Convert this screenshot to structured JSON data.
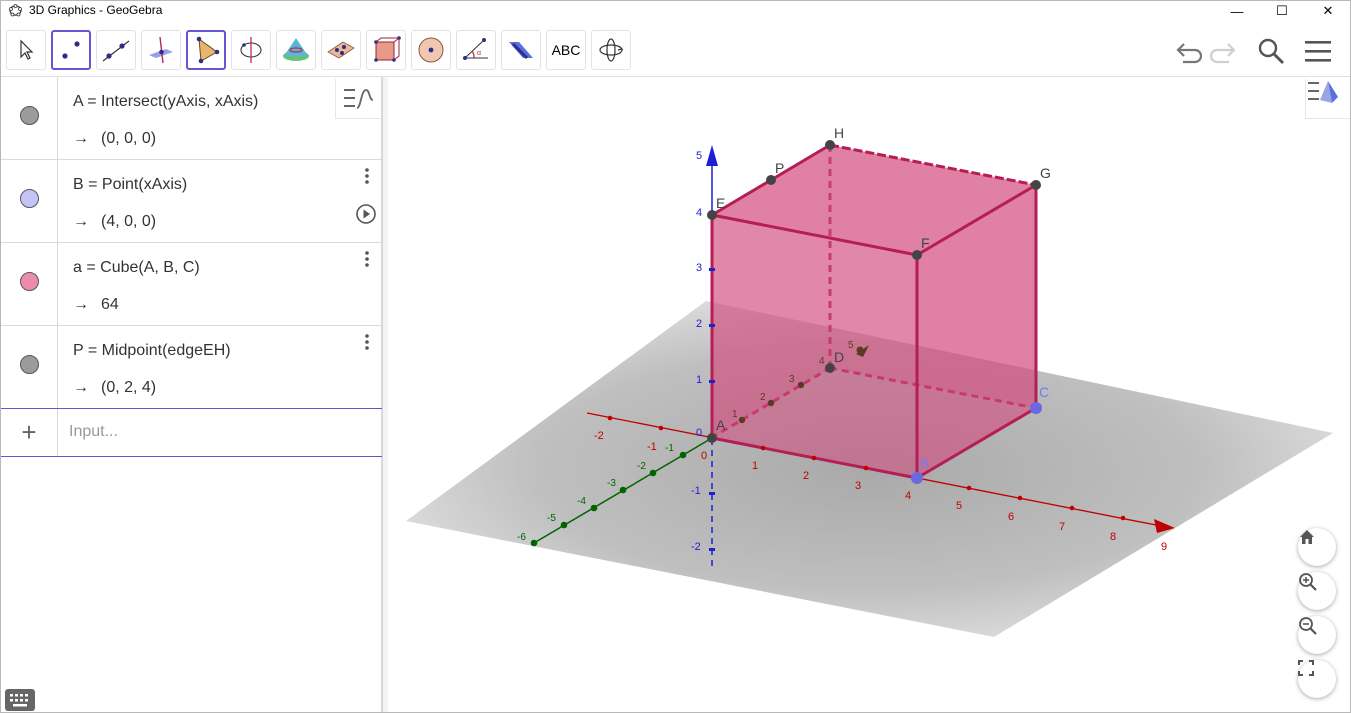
{
  "window": {
    "title": "3D Graphics - GeoGebra",
    "minimize_glyph": "—",
    "maximize_glyph": "☐",
    "close_glyph": "✕"
  },
  "toolbar": {
    "tools": [
      {
        "name": "move-tool-icon",
        "selected": false
      },
      {
        "name": "point-tool-icon",
        "selected": true
      },
      {
        "name": "line-tool-icon",
        "selected": false
      },
      {
        "name": "perpendicular-line-tool-icon",
        "selected": false
      },
      {
        "name": "polygon-tool-icon",
        "selected": true
      },
      {
        "name": "circle-axis-tool-icon",
        "selected": false
      },
      {
        "name": "intersect-surfaces-tool-icon",
        "selected": false
      },
      {
        "name": "plane-through-points-tool-icon",
        "selected": false
      },
      {
        "name": "pyramid-tool-icon",
        "selected": false
      },
      {
        "name": "sphere-tool-icon",
        "selected": false
      },
      {
        "name": "angle-tool-icon",
        "selected": false
      },
      {
        "name": "reflect-about-plane-tool-icon",
        "selected": false
      },
      {
        "name": "text-tool-icon",
        "selected": false
      },
      {
        "name": "rotate-view-tool-icon",
        "selected": false
      }
    ],
    "text_tool_label": "ABC",
    "right_icons": [
      "undo-icon",
      "redo-icon",
      "search-icon",
      "main-menu-icon"
    ]
  },
  "algebra": {
    "items": [
      {
        "definition": "A = Intersect(yAxis, xAxis)",
        "value": "(0, 0, 0)",
        "marble_color": "#9b9b9b",
        "has_menu": false,
        "has_play": false
      },
      {
        "definition": "B = Point(xAxis)",
        "value": "(4, 0, 0)",
        "marble_color": "#c5c4f6",
        "has_menu": true,
        "has_play": true
      },
      {
        "definition": "a = Cube(A, B, C)",
        "value": "64",
        "marble_color": "#ec8cab",
        "has_menu": true,
        "has_play": false
      },
      {
        "definition": "P = Midpoint(edgeEH)",
        "value": "(0, 2, 4)",
        "marble_color": "#9b9b9b",
        "has_menu": true,
        "has_play": false
      }
    ],
    "value_arrow": "→",
    "input_placeholder": "Input...",
    "input_plus": "+"
  },
  "graphics3d": {
    "cube_color": "#d24a7c",
    "point_labels": {
      "A": "A",
      "B": "B",
      "C": "C",
      "D": "D",
      "E": "E",
      "F": "F",
      "G": "G",
      "H": "H",
      "P": "P"
    },
    "x_axis_ticks": [
      "-2",
      "-1",
      "0",
      "1",
      "2",
      "3",
      "4",
      "5",
      "6",
      "7",
      "8",
      "9"
    ],
    "y_axis_ticks": [
      "-6",
      "-5",
      "-4",
      "-3",
      "-2",
      "-1",
      "1",
      "2",
      "3",
      "4",
      "5"
    ],
    "z_axis_ticks": [
      "-2",
      "-1",
      "0",
      "1",
      "2",
      "3",
      "4",
      "5"
    ],
    "axis_colors": {
      "x": "#c00000",
      "y": "#006400",
      "z": "#1e1ed6"
    },
    "zoom_buttons": [
      "home-icon",
      "zoom-in-icon",
      "zoom-out-icon",
      "fullscreen-icon"
    ]
  }
}
